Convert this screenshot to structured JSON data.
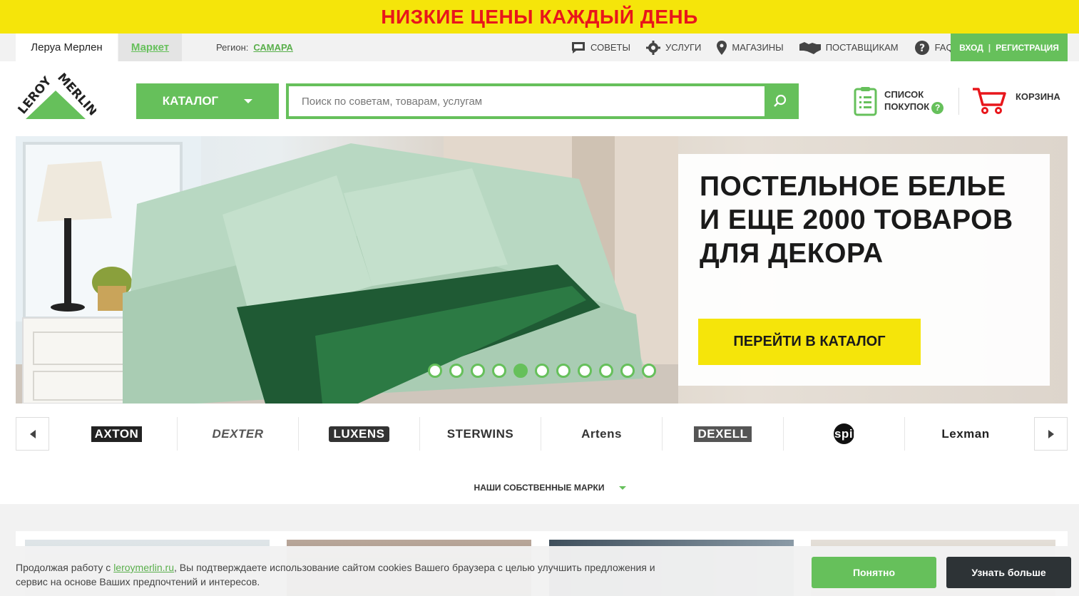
{
  "promo": {
    "text": "НИЗКИЕ ЦЕНЫ КАЖДЫЙ ДЕНЬ"
  },
  "topnav": {
    "tabs": [
      {
        "label": "Леруа Мерлен"
      },
      {
        "label": "Маркет"
      }
    ],
    "region_label": "Регион:",
    "region_city": "САМАРА",
    "links": [
      {
        "label": "СОВЕТЫ",
        "icon": "chat-icon"
      },
      {
        "label": "УСЛУГИ",
        "icon": "gear-icon"
      },
      {
        "label": "МАГАЗИНЫ",
        "icon": "location-pin-icon"
      },
      {
        "label": "ПОСТАВЩИКАМ",
        "icon": "handshake-icon"
      },
      {
        "label": "FAQ",
        "icon": "question-icon"
      }
    ],
    "login": "ВХОД",
    "register": "РЕГИСТРАЦИЯ"
  },
  "header": {
    "logo_text": [
      "LEROY",
      "MERLIN"
    ],
    "catalog_label": "КАТАЛОГ",
    "search_placeholder": "Поиск по советам, товарам, услугам",
    "shopping_list_line1": "СПИСОК",
    "shopping_list_line2": "ПОКУПОК",
    "help_mark": "?",
    "cart_label": "КОРЗИНА"
  },
  "hero": {
    "title_lines": [
      "ПОСТЕЛЬНОЕ  БЕЛЬЕ",
      "И ЕЩЕ 2000 ТОВАРОВ",
      "ДЛЯ ДЕКОРА"
    ],
    "cta": "ПЕРЕЙТИ В КАТАЛОГ",
    "slide_count": 11,
    "active_slide": 5
  },
  "brands": {
    "items": [
      "AXTON",
      "DEXTER",
      "LUXENS",
      "STERWINS",
      "Artens",
      "DEXELL",
      "inspire",
      "Lexman"
    ]
  },
  "own_brands_label": "НАШИ СОБСТВЕННЫЕ МАРКИ",
  "cookie": {
    "text_before": "Продолжая работу с ",
    "link": "leroymerlin.ru",
    "text_after": ", Вы подтверждаете использование сайтом cookies Вашего браузера с целью улучшить предложения и сервис на основе Ваших предпочтений и интересов.",
    "ok_label": "Понятно",
    "more_label": "Узнать больше"
  },
  "colors": {
    "accent_green": "#66c05b",
    "promo_yellow": "#f5e50a",
    "promo_red": "#e8161b",
    "dark_button": "#2d3336"
  }
}
